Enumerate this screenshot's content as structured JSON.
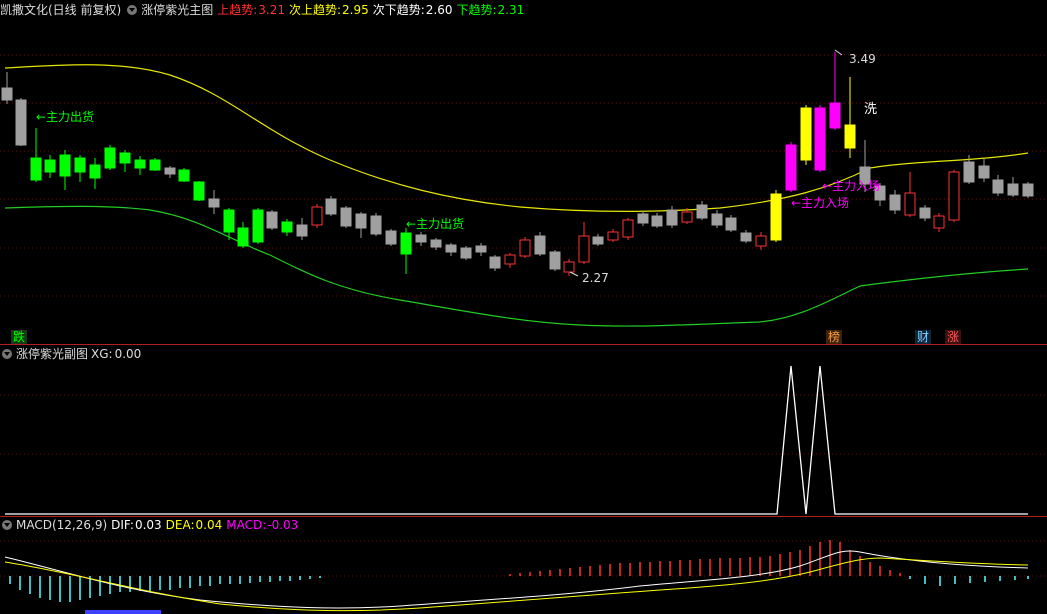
{
  "main_header": {
    "stock": "凯撒文化(日线 前复权)",
    "indicator": "涨停紫光主图",
    "up_label": "上趋势:",
    "up_value": "3.21",
    "sub_up_label": "次上趋势:",
    "sub_up_value": "2.95",
    "sub_down_label": "次下趋势:",
    "sub_down_value": "2.60",
    "down_label": "下趋势:",
    "down_value": "2.31"
  },
  "annotations": {
    "sell1": "←主力出货",
    "sell2": "←主力出货",
    "enter1": "←主力入场",
    "enter2": "←主力入场",
    "high": "3.49",
    "low": "2.27",
    "wash": "洗"
  },
  "bottom_tags": {
    "die": "跌",
    "bang": "榜",
    "cai": "财",
    "zhang": "涨"
  },
  "sub_header": {
    "indicator": "涨停紫光副图",
    "xg_label": "XG:",
    "xg_value": "0.00"
  },
  "macd_header": {
    "name": "MACD(12,26,9)",
    "dif_label": "DIF:",
    "dif_value": "0.03",
    "dea_label": "DEA:",
    "dea_value": "0.04",
    "macd_label": "MACD:",
    "macd_value": "-0.03"
  },
  "colors": {
    "up": "#ff3232",
    "down": "#00ff00",
    "neutral": "#a0a0a0",
    "magenta": "#ff00ff",
    "yellow": "#ffff00",
    "xg_line": "#ffffff",
    "dif": "#ffffff",
    "dea": "#ffff00",
    "macd_pos": "#ff3232",
    "macd_neg": "#54ffff"
  }
}
